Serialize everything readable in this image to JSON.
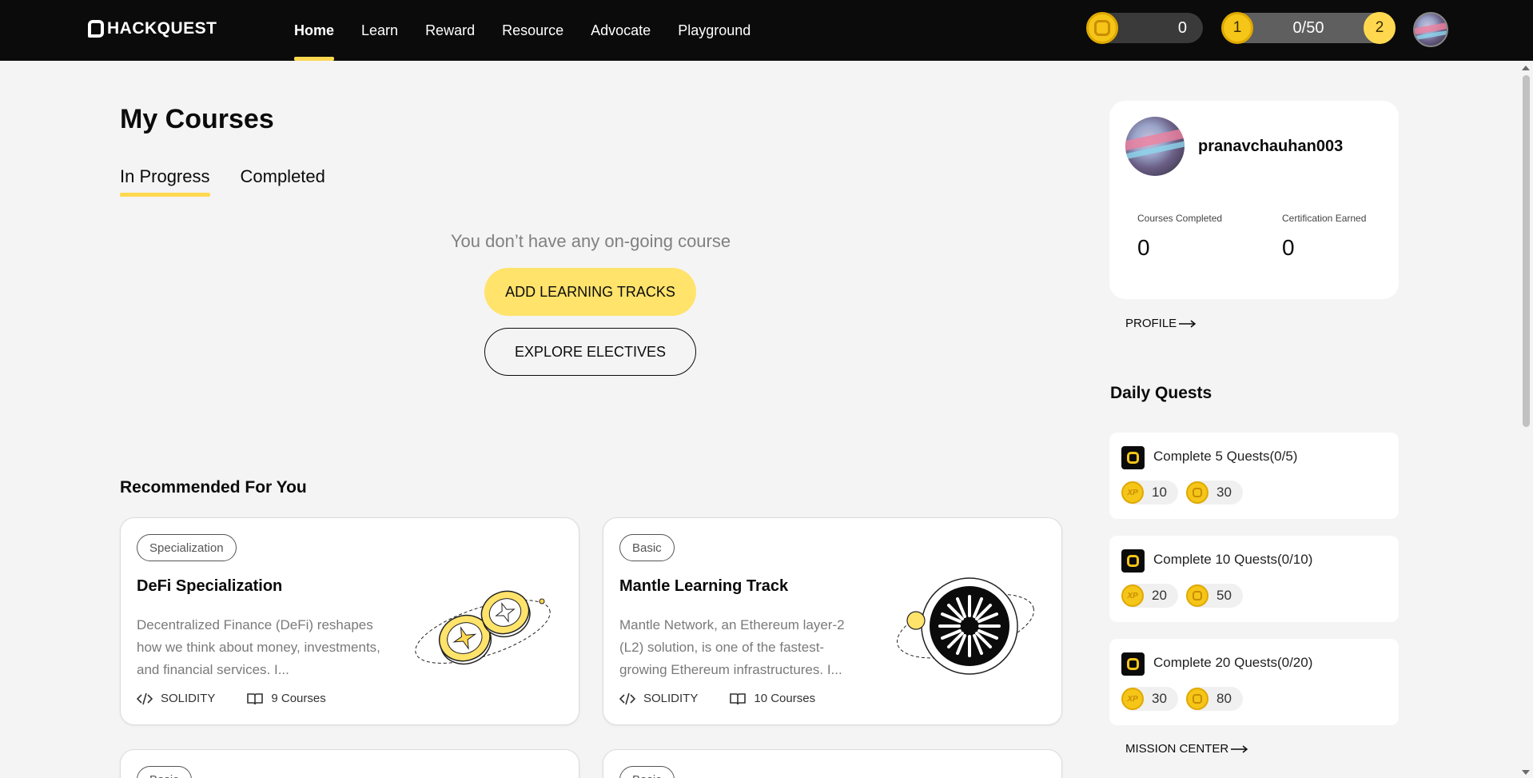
{
  "brand": {
    "name": "HACKQUEST"
  },
  "nav": {
    "items": [
      {
        "label": "Home",
        "active": true
      },
      {
        "label": "Learn"
      },
      {
        "label": "Reward"
      },
      {
        "label": "Resource"
      },
      {
        "label": "Advocate"
      },
      {
        "label": "Playground"
      }
    ]
  },
  "header": {
    "coins": "0",
    "level_left": "1",
    "level_progress": "0/50",
    "level_right": "2"
  },
  "page": {
    "title": "My Courses",
    "tabs": [
      {
        "label": "In Progress",
        "active": true
      },
      {
        "label": "Completed"
      }
    ],
    "empty_message": "You don’t have any on-going course",
    "add_tracks_label": "ADD LEARNING TRACKS",
    "explore_label": "EXPLORE ELECTIVES"
  },
  "recommended": {
    "title": "Recommended For You",
    "cards": [
      {
        "badge": "Specialization",
        "title": "DeFi Specialization",
        "description": "Decentralized Finance (DeFi) reshapes how we think about money, investments, and financial services. I...",
        "language": "SOLIDITY",
        "courses": "9 Courses"
      },
      {
        "badge": "Basic",
        "title": "Mantle Learning Track",
        "description": "Mantle Network, an Ethereum layer-2 (L2) solution, is one of the fastest-growing Ethereum infrastructures. I...",
        "language": "SOLIDITY",
        "courses": "10 Courses"
      },
      {
        "badge": "Basic"
      },
      {
        "badge": "Basic"
      }
    ]
  },
  "profile": {
    "username": "pranavchauhan003",
    "courses_completed_label": "Courses Completed",
    "courses_completed": "0",
    "certification_label": "Certification Earned",
    "certification": "0",
    "profile_link": "PROFILE"
  },
  "quests": {
    "title": "Daily Quests",
    "items": [
      {
        "title": "Complete 5 Quests(0/5)",
        "xp": "10",
        "coins": "30"
      },
      {
        "title": "Complete 10 Quests(0/10)",
        "xp": "20",
        "coins": "50"
      },
      {
        "title": "Complete 20 Quests(0/20)",
        "xp": "30",
        "coins": "80"
      }
    ],
    "mission_link": "MISSION CENTER"
  },
  "icons": {
    "xp_label": "XP"
  },
  "colors": {
    "accent": "#ffd850",
    "nav_bg": "#0b0b0b",
    "coin": "#f5c518"
  }
}
